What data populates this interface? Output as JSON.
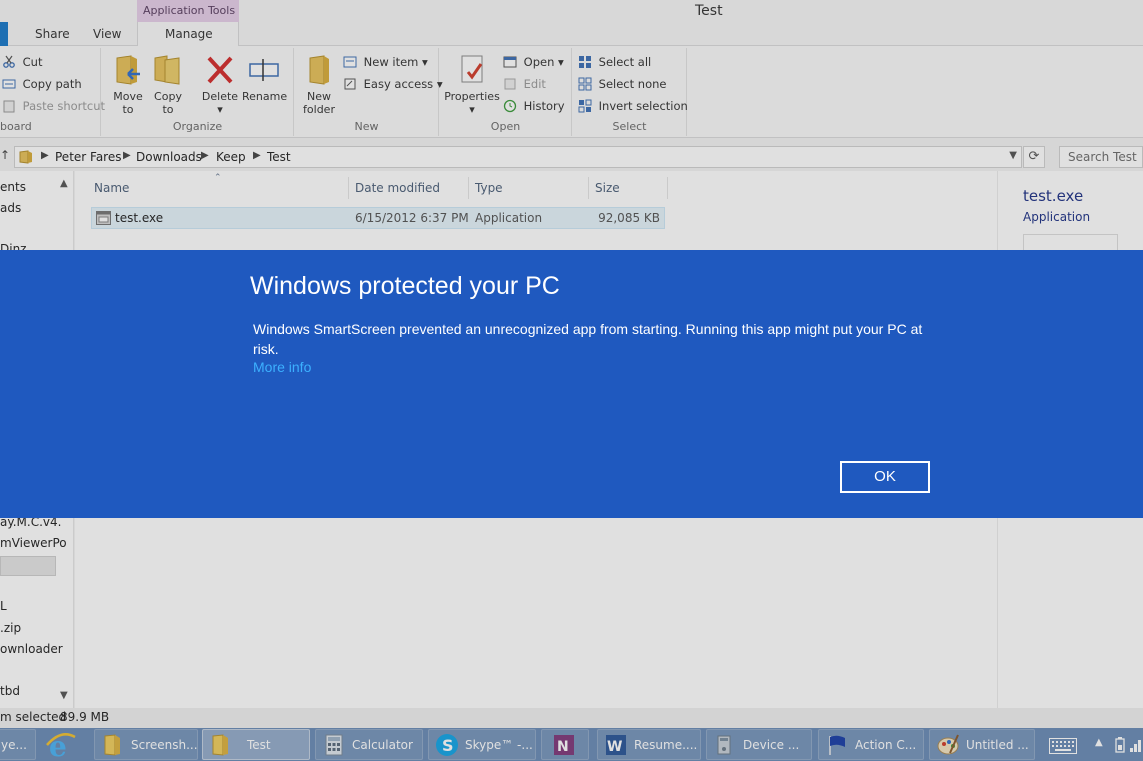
{
  "window": {
    "title": "Test",
    "contextual_tab": "Application Tools"
  },
  "ribbon_tabs": [
    {
      "label": "Share"
    },
    {
      "label": "View"
    },
    {
      "label": "Manage"
    }
  ],
  "ribbon": {
    "clipboard": {
      "cut": "Cut",
      "copy_path": "Copy path",
      "paste_shortcut": "Paste shortcut",
      "group": "board"
    },
    "organize": {
      "move_to_1": "Move",
      "move_to_2": "to",
      "copy_to_1": "Copy",
      "copy_to_2": "to",
      "delete": "Delete",
      "rename": "Rename",
      "group": "Organize"
    },
    "new": {
      "new_folder_1": "New",
      "new_folder_2": "folder",
      "new_item": "New item",
      "easy_access": "Easy access",
      "group": "New"
    },
    "open": {
      "properties": "Properties",
      "open": "Open",
      "edit": "Edit",
      "history": "History",
      "group": "Open"
    },
    "select": {
      "select_all": "Select all",
      "select_none": "Select none",
      "invert_selection": "Invert selection",
      "group": "Select"
    }
  },
  "address": {
    "crumbs": [
      "Peter Fares",
      "Downloads",
      "Keep",
      "Test"
    ],
    "search_placeholder": "Search Test"
  },
  "nav_items": [
    "ents",
    "ads",
    "Dinz",
    "ay.M.C.v4.",
    "mViewerPo",
    "L",
    ".zip",
    "ownloader",
    "tbd"
  ],
  "columns": {
    "name": "Name",
    "date": "Date modified",
    "type": "Type",
    "size": "Size"
  },
  "files": [
    {
      "name": "test.exe",
      "date": "6/15/2012 6:37 PM",
      "type": "Application",
      "size": "92,085 KB"
    }
  ],
  "preview": {
    "name": "test.exe",
    "type": "Application"
  },
  "status": {
    "selected": "m selected",
    "size": "89.9 MB"
  },
  "smartscreen": {
    "title": "Windows protected your PC",
    "message": "Windows SmartScreen prevented an unrecognized app from starting. Running this app might put your PC at risk.",
    "more_info": "More info",
    "ok": "OK"
  },
  "taskbar": [
    {
      "label": "ye...",
      "icon": "app-icon"
    },
    {
      "label": "Screensh...",
      "icon": "folder-icon"
    },
    {
      "label": "Test",
      "icon": "folder-icon"
    },
    {
      "label": "Calculator",
      "icon": "calculator-icon"
    },
    {
      "label": "Skype™ -...",
      "icon": "skype-icon"
    },
    {
      "label": "Resume....",
      "icon": "word-icon"
    },
    {
      "label": "Device ...",
      "icon": "device-icon"
    },
    {
      "label": "Action C...",
      "icon": "flag-icon"
    },
    {
      "label": "Untitled ...",
      "icon": "paint-icon"
    }
  ],
  "colors": {
    "smartscreen_bg": "#1f59bf",
    "link": "#3cb0ff",
    "taskbar": "#6b8cb7"
  }
}
